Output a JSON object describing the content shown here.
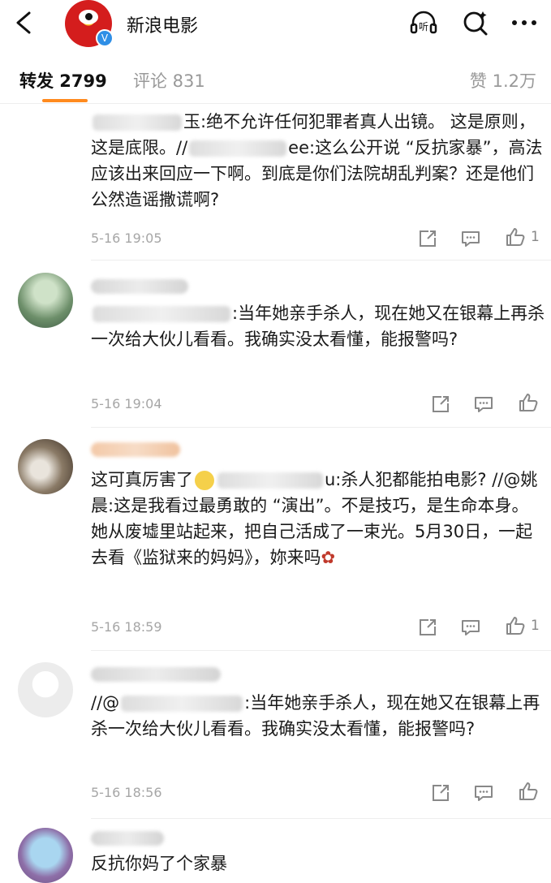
{
  "header": {
    "title": "新浪电影",
    "verified_badge": "V",
    "icons": [
      "back-arrow-icon",
      "listen-icon",
      "search-icon",
      "more-icon"
    ],
    "listen_label": "听"
  },
  "tabs": {
    "repost": "转发 2799",
    "comments": "评论 831",
    "likes": "赞 1.2万"
  },
  "comments": [
    {
      "segments": [
        "玉:绝不允许任何犯罪者真人出镜。 这是原则，这是底限。//",
        "ee:这么公开说 “反抗家暴”，高法应该出来回应一下啊。到底是你们法院胡乱判案？还是他们公然造谣撒谎啊?"
      ],
      "time": "5-16 19:05",
      "likes": "1"
    },
    {
      "segments": [
        "",
        ":当年她亲手杀人，现在她又在银幕上再杀一次给大伙儿看看。我确实没太看懂，能报警吗?"
      ],
      "time": "5-16 19:04",
      "likes": ""
    },
    {
      "segments": [
        "这可真厉害了",
        "u:杀人犯都能拍电影? //@姚晨:这是我看过最勇敢的 “演出”。不是技巧，是生命本身。她从废墟里站起来，把自己活成了一束光。5月30日，一起去看《监狱来的妈妈》，妳来吗"
      ],
      "time": "5-16 18:59",
      "likes": "1"
    },
    {
      "segments": [
        "//@",
        ":当年她亲手杀人，现在她又在银幕上再杀一次给大伙儿看看。我确实没太看懂，能报警吗?"
      ],
      "time": "5-16 18:56",
      "likes": ""
    },
    {
      "segments": [
        "反抗你妈了个家暴"
      ]
    }
  ],
  "colors": {
    "accent": "#ff8a1e",
    "verified": "#2f8fe6",
    "muted": "#a6a6a6"
  }
}
